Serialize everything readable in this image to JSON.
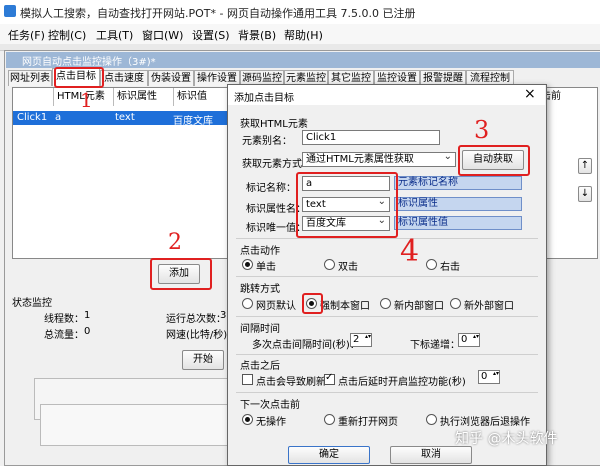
{
  "app": {
    "title": "模拟人工搜索，自动查找打开网站.POT* - 网页自动操作通用工具 7.5.0.0 已注册"
  },
  "menu": [
    "任务(F)",
    "控制(C)",
    "工具(T)",
    "窗口(W)",
    "设置(S)",
    "背景(B)",
    "帮助(H)"
  ],
  "inner_window": {
    "title": "网页自动点击监控操作（3#)*",
    "tabs": [
      "网址列表",
      "点击目标",
      "点击速度",
      "伪装设置",
      "操作设置",
      "源码监控",
      "元素监控",
      "其它监控",
      "监控设置",
      "报警提醒",
      "流程控制"
    ],
    "grid": {
      "columns": [
        "HTML元素",
        "标识属性",
        "标识值",
        "击前"
      ],
      "rows": [
        {
          "name": "Click1",
          "element": "a",
          "attr": "text",
          "value": "百度文库"
        }
      ]
    },
    "add_button": "添加",
    "status": {
      "heading": "状态监控",
      "thread_label": "线程数：",
      "thread_value": "1",
      "run_count_label": "运行总次数：",
      "run_count_value": "3",
      "traffic_label": "总流量：",
      "traffic_value": "0",
      "speed_label": "网速(比特/秒)",
      "start_button": "开始"
    }
  },
  "dialog": {
    "title": "添加点击目标",
    "close": "×",
    "section_get": "获取HTML元素",
    "alias_label": "元素别名：",
    "alias_value": "Click1",
    "method_label": "获取元素方式：",
    "method_value": "通过HTML元素属性获取",
    "auto_button": "自动获取",
    "tag_label": "标记名称：",
    "tag_value": "a",
    "tag_hint": "元素标记名称",
    "attr_label": "标识属性名：",
    "attr_value": "text",
    "attr_hint": "标识属性",
    "uniq_label": "标识唯一值：",
    "uniq_value": "百度文库",
    "uniq_hint": "标识属性值",
    "section_action": "点击动作",
    "action_options": [
      "单击",
      "双击",
      "右击"
    ],
    "action_selected": "单击",
    "section_jump": "跳转方式",
    "jump_options": [
      "网页默认",
      "强制本窗口",
      "新内部窗口",
      "新外部窗口"
    ],
    "jump_selected": "强制本窗口",
    "section_interval": "间隔时间",
    "interval_label": "多次点击间隔时间(秒)：",
    "interval_value": "2",
    "depth_label": "下标递增：",
    "depth_value": "0",
    "section_after": "点击之后",
    "after_refresh": "点击会导致刷新",
    "after_refresh_checked": false,
    "after_delay": "点击后延时开启监控功能(秒)",
    "after_delay_checked": true,
    "after_delay_value": "0",
    "section_next": "下一次点击前",
    "next_options": [
      "无操作",
      "重新打开网页",
      "执行浏览器后退操作"
    ],
    "next_selected": "无操作",
    "ok_button": "确定",
    "cancel_button": "取消"
  },
  "annotations": [
    "1",
    "2",
    "3",
    "4"
  ],
  "watermark": "知乎 @木头软件",
  "colors": {
    "selection": "#1e6fd9",
    "annotation": "#e02020",
    "hint_bar": "#c5d6ef"
  }
}
